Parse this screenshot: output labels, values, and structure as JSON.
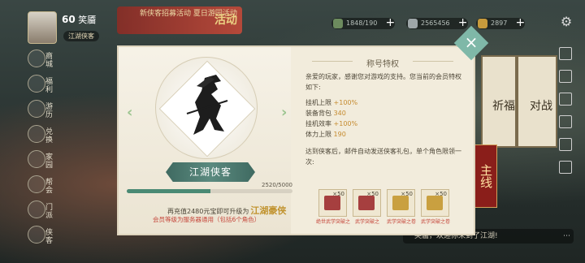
{
  "header": {
    "level": "60",
    "player_name": "笑靥",
    "title_tag": "江湖侠客",
    "event_banner": "新侠客招募活动 夏日游园活动",
    "event_label": "活动",
    "resources": [
      {
        "name": "stamina-icon",
        "value": "1848/190",
        "color": "#6c8b5e"
      },
      {
        "name": "silver-icon",
        "value": "2565456",
        "color": "#9ea6a8"
      },
      {
        "name": "gold-icon",
        "value": "2897",
        "color": "#c79a3c"
      }
    ]
  },
  "left_nav": [
    {
      "label": "商城",
      "icon": "shop-icon"
    },
    {
      "label": "福利",
      "icon": "gift-icon"
    },
    {
      "label": "游历",
      "icon": "travel-icon"
    },
    {
      "label": "兑换",
      "icon": "exchange-icon"
    },
    {
      "label": "家园",
      "icon": "home-icon"
    },
    {
      "label": "帮会",
      "icon": "guild-icon"
    },
    {
      "label": "门派",
      "icon": "sect-icon"
    },
    {
      "label": "侠客",
      "icon": "hero-icon"
    }
  ],
  "side_buildings": {
    "left_label": "祈福",
    "right_label": "对战",
    "main_button": "主线"
  },
  "chat": {
    "text": "笑靥，欢迎你来到了江湖!"
  },
  "dialog": {
    "section_title": "称号特权",
    "rank_name": "江湖侠客",
    "progress_text": "2520/5000",
    "progress": 0.504,
    "recharge_text": "再充值2480元宝即可升级为",
    "next_rank": "江湖豪侠",
    "note": "会员等级为服务器通用（包括6个角色）",
    "description": "亲爱的玩家，感谢您对游戏的支持。您当前的会员特权如下:",
    "perks": [
      {
        "name": "挂机上限",
        "value": "+100%"
      },
      {
        "name": "装备背包",
        "value": "340"
      },
      {
        "name": "挂机效率",
        "value": "+100%"
      },
      {
        "name": "体力上限",
        "value": "190"
      }
    ],
    "reach_text": "达到侠客后，邮件自动发送侠客礼包，单个角色限领一次:",
    "gifts": [
      {
        "qty": "×50",
        "label": "绝世武学突破之",
        "color": "#a63f3f"
      },
      {
        "qty": "×50",
        "label": "武学突破之",
        "color": "#a63f3f"
      },
      {
        "qty": "×50",
        "label": "武学突破之卷",
        "color": "#c9a040"
      },
      {
        "qty": "×50",
        "label": "武学突破之卷",
        "color": "#c9a040"
      }
    ]
  }
}
